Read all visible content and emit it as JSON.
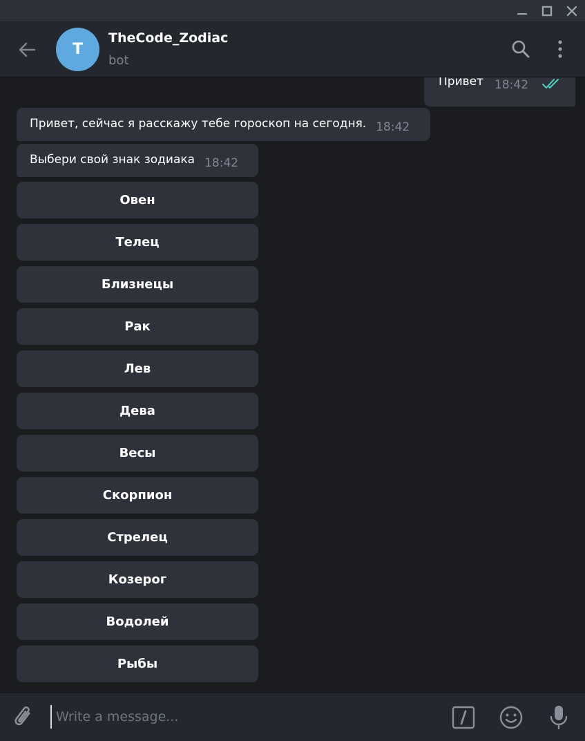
{
  "header": {
    "avatar_letter": "T",
    "title": "TheCode_Zodiac",
    "subtitle": "bot"
  },
  "messages": {
    "outgoing": {
      "text": "Привет",
      "time": "18:42"
    },
    "incoming": [
      {
        "text": "Привет, сейчас я расскажу тебе гороскоп на сегодня.",
        "time": "18:42"
      },
      {
        "text": "Выбери свой знак зодиака",
        "time": "18:42"
      }
    ]
  },
  "keyboard": {
    "buttons": [
      {
        "label": "Овен"
      },
      {
        "label": "Телец"
      },
      {
        "label": "Близнецы"
      },
      {
        "label": "Рак"
      },
      {
        "label": "Лев"
      },
      {
        "label": "Дева"
      },
      {
        "label": "Весы"
      },
      {
        "label": "Скорпион"
      },
      {
        "label": "Стрелец"
      },
      {
        "label": "Козерог"
      },
      {
        "label": "Водолей"
      },
      {
        "label": "Рыбы"
      }
    ]
  },
  "composer": {
    "placeholder": "Write a message...",
    "value": ""
  },
  "icons": {
    "back": "arrow-left-icon",
    "search": "search-icon",
    "menu": "more-vertical-icon",
    "attach": "paperclip-icon",
    "commands": "bot-command-icon",
    "emoji": "emoji-icon",
    "mic": "microphone-icon",
    "read": "double-check-icon"
  },
  "colors": {
    "accent": "#5ea9e0",
    "read_check": "#4fd1c5",
    "bubble": "#2f323a",
    "background": "#1b1c20",
    "header": "#24272d"
  }
}
